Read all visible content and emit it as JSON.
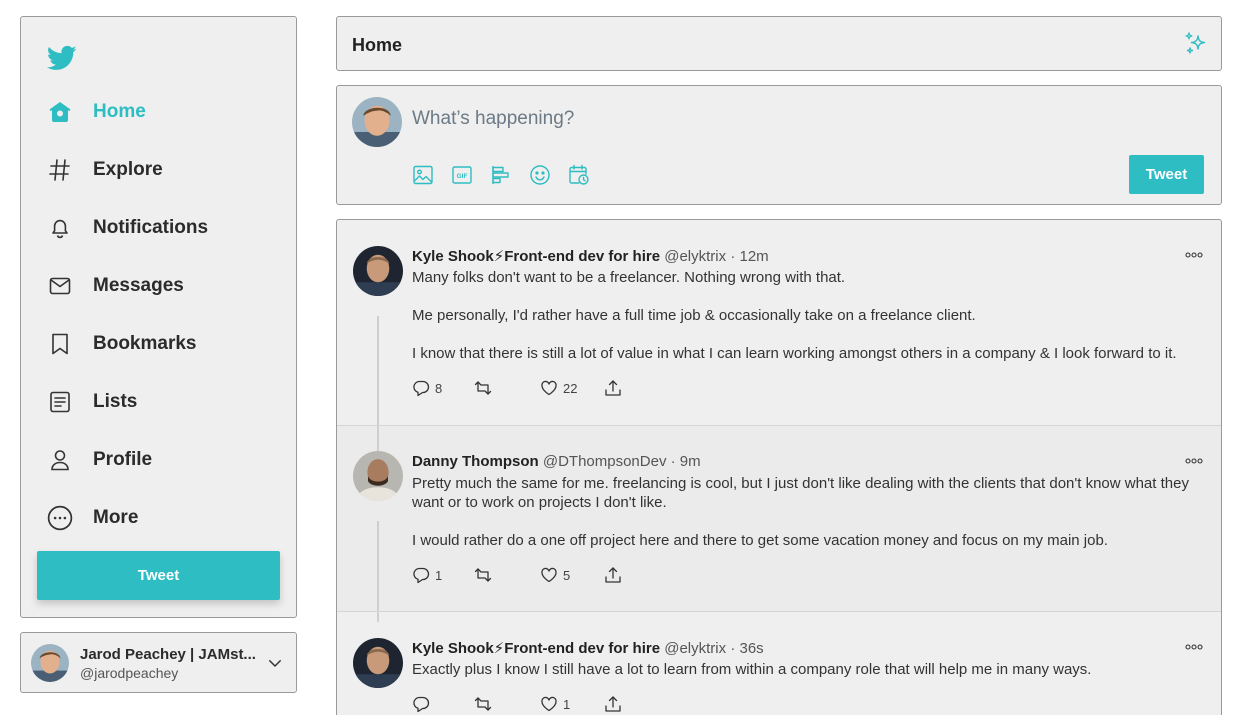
{
  "colors": {
    "accent": "#2ebdc2",
    "panel": "#efefef",
    "border": "#9a9a9a"
  },
  "sidebar": {
    "logo_icon": "bird-icon",
    "items": [
      {
        "label": "Home",
        "icon": "home-icon",
        "active": true
      },
      {
        "label": "Explore",
        "icon": "hashtag-icon"
      },
      {
        "label": "Notifications",
        "icon": "bell-icon"
      },
      {
        "label": "Messages",
        "icon": "envelope-icon"
      },
      {
        "label": "Bookmarks",
        "icon": "bookmark-icon"
      },
      {
        "label": "Lists",
        "icon": "list-icon"
      },
      {
        "label": "Profile",
        "icon": "person-icon"
      },
      {
        "label": "More",
        "icon": "more-circle-icon"
      }
    ],
    "tweet_button": "Tweet"
  },
  "account": {
    "name": "Jarod Peachey | JAMst...",
    "handle": "@jarodpeachey"
  },
  "header": {
    "title": "Home",
    "icon": "sparkle-icon"
  },
  "compose": {
    "placeholder": "What’s happening?",
    "tools": [
      "image-icon",
      "gif-icon",
      "poll-icon",
      "emoji-icon",
      "schedule-icon"
    ],
    "tweet_button": "Tweet"
  },
  "feed": [
    {
      "name": "Kyle Shook⚡Front-end dev for hire",
      "handle": "@elyktrix",
      "time": "12m",
      "paragraphs": [
        "Many folks don't want to be a freelancer. Nothing wrong with that.",
        "Me personally, I'd rather have a full time job & occasionally take on a freelance client.",
        "I know that there is still a lot of value in what I can learn working amongst others in a company & I look forward to it."
      ],
      "replies": "8",
      "retweets": "",
      "likes": "22"
    },
    {
      "name": "Danny Thompson",
      "handle": "@DThompsonDev",
      "time": "9m",
      "paragraphs": [
        "Pretty much the same for me. freelancing is cool, but I just don't like dealing with the clients that don't know what they want or to work on projects I don't like.",
        "I would rather do a one off project here and there to get some vacation money and focus on my main job."
      ],
      "replies": "1",
      "retweets": "",
      "likes": "5"
    },
    {
      "name": "Kyle Shook⚡Front-end dev for hire",
      "handle": "@elyktrix",
      "time": "36s",
      "paragraphs": [
        "Exactly plus I know I still have a lot to learn from within a company role that will help me in many ways."
      ],
      "replies": "",
      "retweets": "",
      "likes": "1"
    }
  ]
}
